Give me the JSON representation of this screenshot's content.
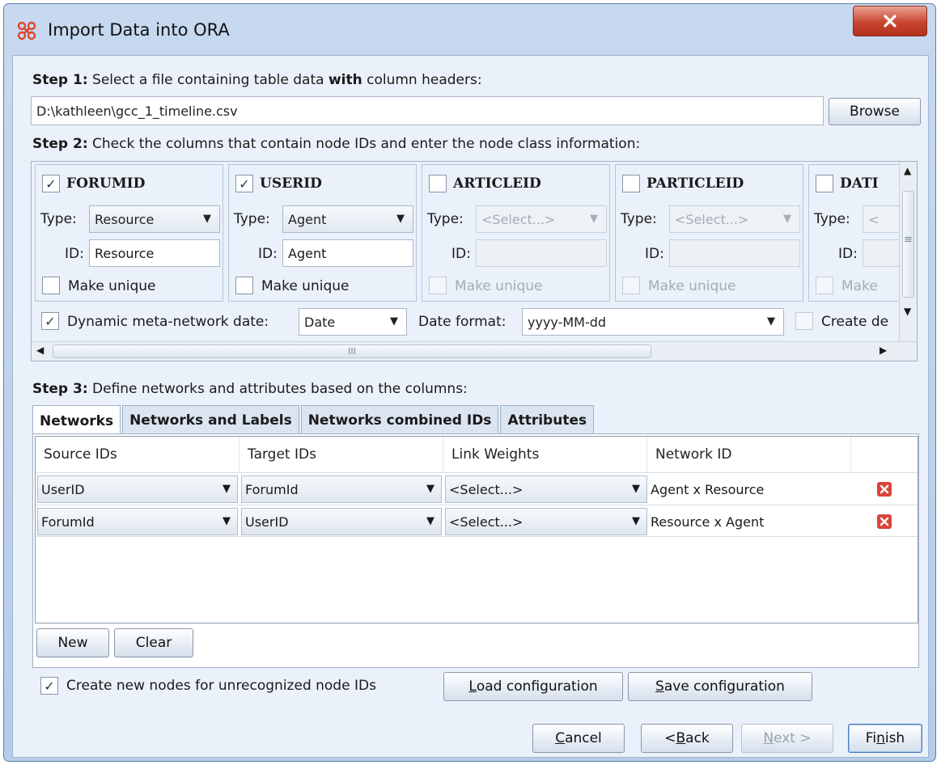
{
  "window": {
    "title": "Import Data into ORA",
    "close_label": "X"
  },
  "step1": {
    "label_bold": "Step 1:",
    "label_pre": " Select a file containing table data ",
    "label_with": "with",
    "label_post": " column headers:",
    "file_path": "D:\\kathleen\\gcc_1_timeline.csv",
    "browse_label": "Browse"
  },
  "step2": {
    "label_bold": "Step 2:",
    "label_text": " Check the columns that contain node IDs and enter the node class information:",
    "columns": [
      {
        "name": "FORUMID",
        "checked": true,
        "type_label": "Type:",
        "type_value": "Resource",
        "id_label": "ID:",
        "id_value": "Resource",
        "unique_label": "Make unique"
      },
      {
        "name": "USERID",
        "checked": true,
        "type_label": "Type:",
        "type_value": "Agent",
        "id_label": "ID:",
        "id_value": "Agent",
        "unique_label": "Make unique"
      },
      {
        "name": "ARTICLEID",
        "checked": false,
        "type_label": "Type:",
        "type_value": "<Select...>",
        "id_label": "ID:",
        "id_value": "",
        "unique_label": "Make unique"
      },
      {
        "name": "PARTICLEID",
        "checked": false,
        "type_label": "Type:",
        "type_value": "<Select...>",
        "id_label": "ID:",
        "id_value": "",
        "unique_label": "Make unique"
      },
      {
        "name": "DATI",
        "checked": false,
        "type_label": "Type:",
        "type_value": "<",
        "id_label": "ID:",
        "id_value": "",
        "unique_label": "Make"
      }
    ],
    "dynamic_label": "Dynamic meta-network date:",
    "dynamic_checked": true,
    "dynamic_value": "Date",
    "date_format_label": "Date format:",
    "date_format_value": "yyyy-MM-dd",
    "create_label": "Create de",
    "hscroll_grip": "III",
    "vscroll_grip": "≡"
  },
  "step3": {
    "label_bold": "Step 3:",
    "label_text": " Define networks and attributes based on the columns:",
    "tabs": [
      "Networks",
      "Networks and Labels",
      "Networks combined IDs",
      "Attributes"
    ],
    "headers": [
      "Source IDs",
      "Target IDs",
      "Link Weights",
      "Network ID"
    ],
    "rows": [
      {
        "source": "UserID",
        "target": "ForumId",
        "weight": "<Select...>",
        "network": "Agent x Resource"
      },
      {
        "source": "ForumId",
        "target": "UserID",
        "weight": "<Select...>",
        "network": "Resource x Agent"
      }
    ],
    "new_label": "New",
    "clear_label": "Clear"
  },
  "options": {
    "create_nodes_label": "Create new nodes for unrecognized node IDs",
    "create_nodes_checked": true,
    "load_label_u": "L",
    "load_label_rest": "oad configuration",
    "save_label_u": "S",
    "save_label_rest": "ave configuration"
  },
  "footer": {
    "cancel_u": "C",
    "cancel_rest": "ancel",
    "back_pre": "< ",
    "back_u": "B",
    "back_rest": "ack",
    "next_u": "N",
    "next_rest": "ext >",
    "finish_pre": "Fi",
    "finish_u": "n",
    "finish_rest": "ish"
  },
  "colors": {
    "window_bg": "#c6d9ef",
    "client_bg": "#eaf1fa",
    "close_red": "#c8452f",
    "delete_red": "#d9453a",
    "app_icon": "#e0452b"
  },
  "icons": [
    "app-icon",
    "close-icon",
    "checkmark-icon",
    "dropdown-arrow-icon",
    "delete-icon",
    "scroll-arrow-icon"
  ]
}
